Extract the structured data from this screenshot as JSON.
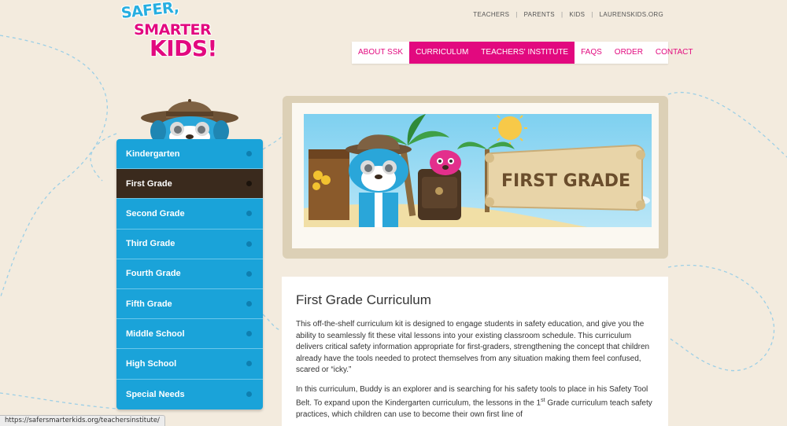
{
  "logo": {
    "line1": "SAFER,",
    "line2": "SMARTER",
    "line3": "KIDS!"
  },
  "top_links": [
    "TEACHERS",
    "PARENTS",
    "KIDS",
    "LAURENSKIDS.ORG"
  ],
  "main_nav": [
    {
      "label": "ABOUT SSK",
      "active": false
    },
    {
      "label": "CURRICULUM",
      "active": true
    },
    {
      "label": "TEACHERS' INSTITUTE",
      "active": true
    },
    {
      "label": "FAQS",
      "active": false
    },
    {
      "label": "ORDER",
      "active": false
    },
    {
      "label": "CONTACT",
      "active": false
    }
  ],
  "sidebar": {
    "items": [
      {
        "label": "Kindergarten"
      },
      {
        "label": "First Grade"
      },
      {
        "label": "Second Grade"
      },
      {
        "label": "Third Grade"
      },
      {
        "label": "Fourth Grade"
      },
      {
        "label": "Fifth Grade"
      },
      {
        "label": "Middle School"
      },
      {
        "label": "High School"
      },
      {
        "label": "Special Needs"
      }
    ],
    "active_index": 1
  },
  "banner": {
    "title": "FIRST GRADE"
  },
  "content": {
    "heading": "First Grade Curriculum",
    "paragraph1": "This off-the-shelf curriculum kit is designed to engage students in safety education, and give you the ability to seamlessly fit these vital lessons into your existing classroom schedule. This curriculum delivers critical safety information appropriate for first-graders, strengthening the concept that children already have the tools needed to protect themselves from any situation making them feel confused, scared or “icky.”",
    "paragraph2_a": "In this curriculum, Buddy is an explorer and is searching for his safety tools to place in his Safety Tool Belt. To expand upon the Kindergarten curriculum, the lessons in the 1",
    "paragraph2_sup": "st",
    "paragraph2_b": " Grade curriculum teach safety practices, which children can use to become their own first line of"
  },
  "status_bar": {
    "url": "https://safersmarterkids.org/teachersinstitute/"
  },
  "colors": {
    "background": "#f3ebde",
    "brand_pink": "#e2097f",
    "brand_blue": "#1aa3d9",
    "active_brown": "#3a2a1d"
  }
}
